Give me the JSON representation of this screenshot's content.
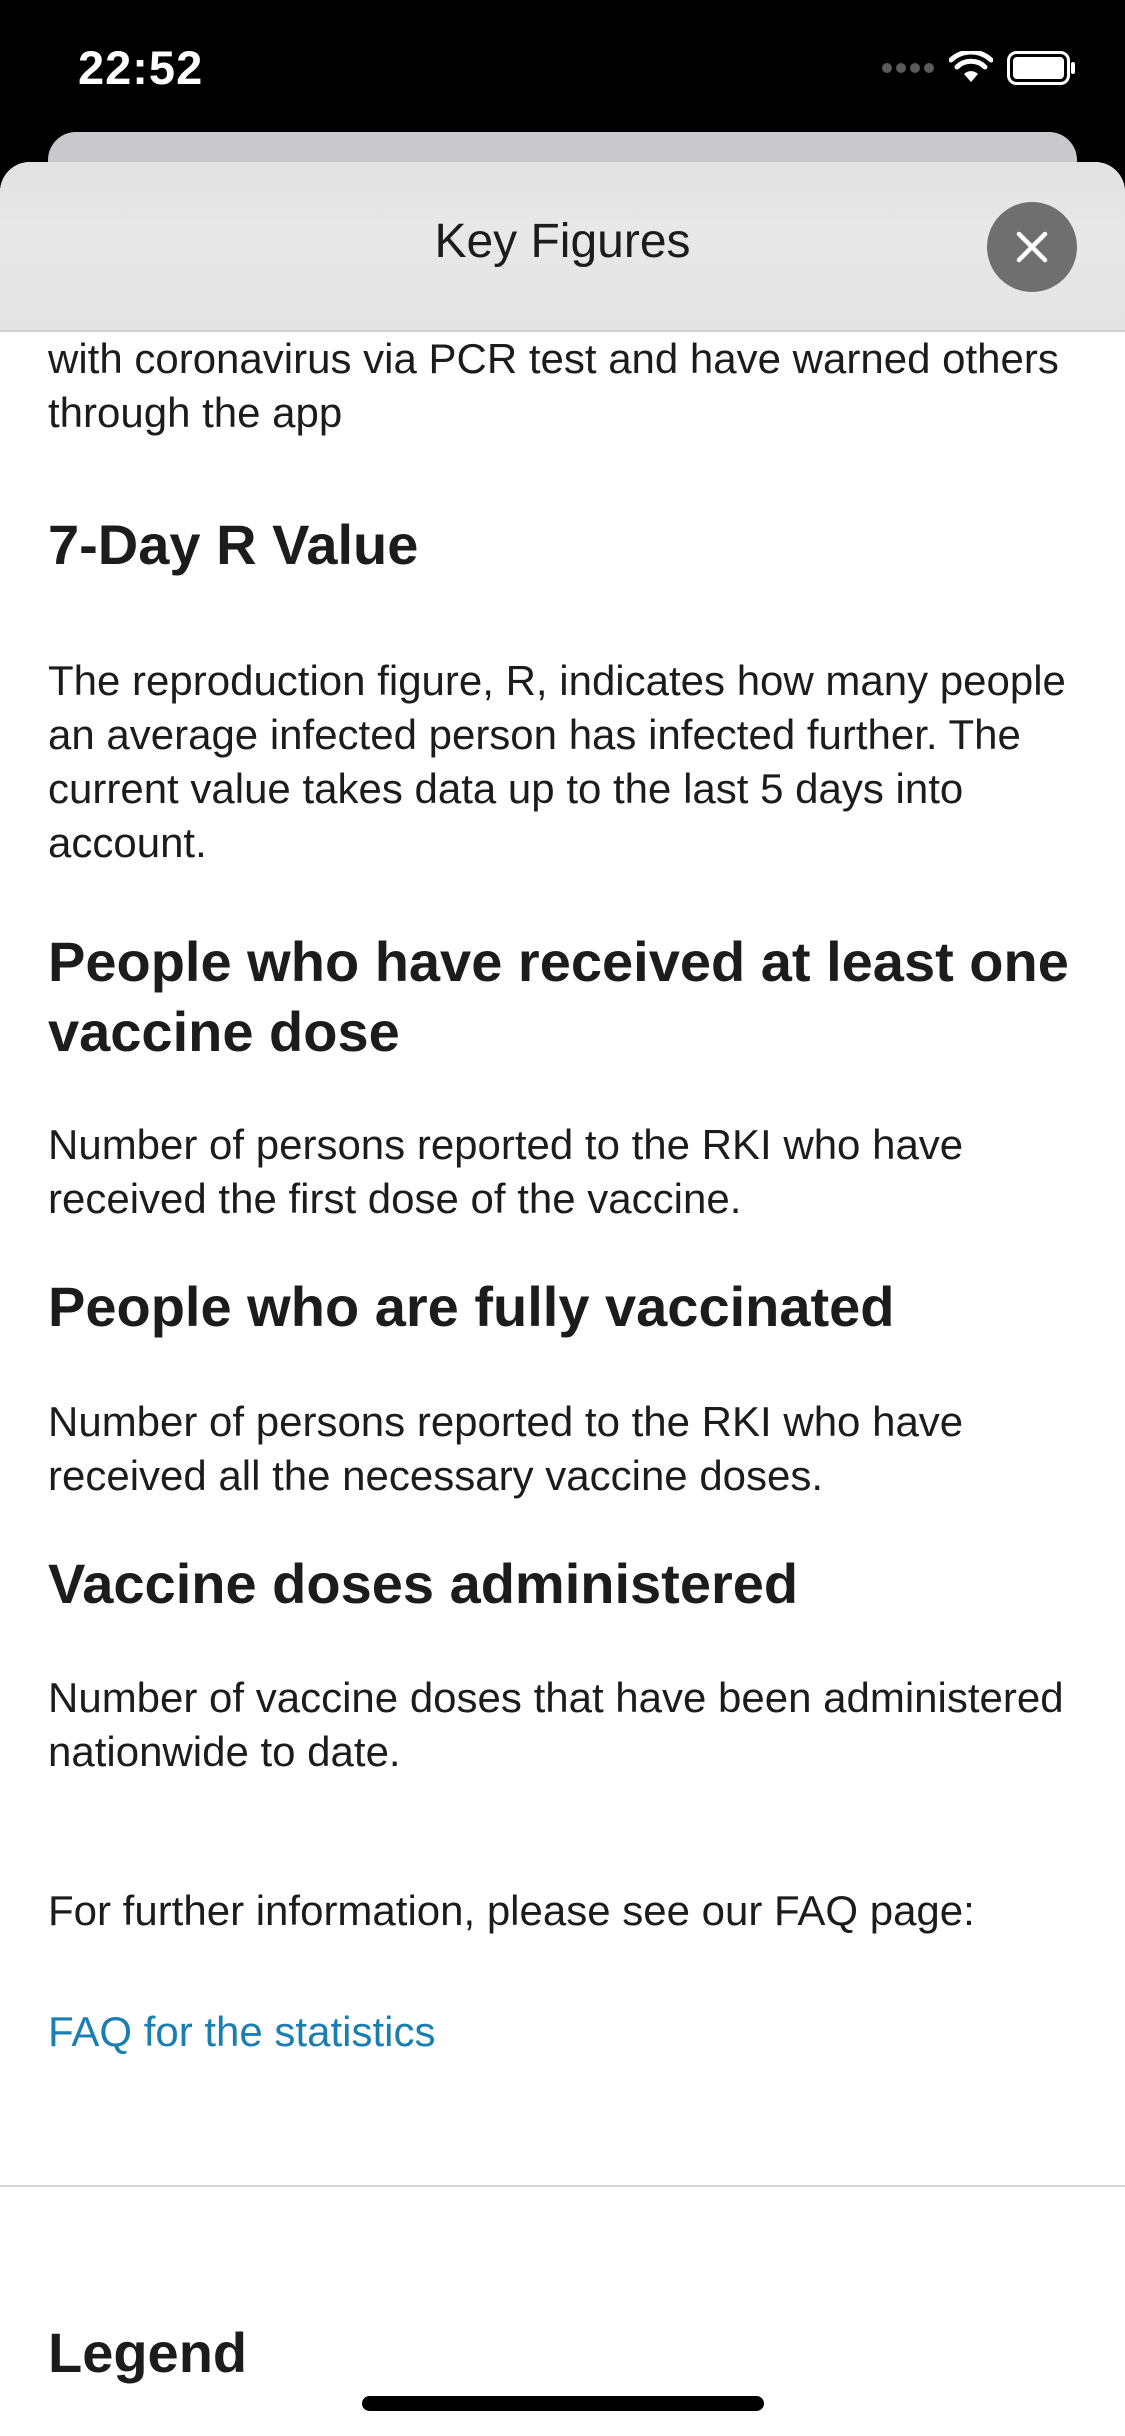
{
  "status_bar": {
    "time": "22:52"
  },
  "header": {
    "title": "Key Figures",
    "close_icon": "close-icon"
  },
  "sections": {
    "intro_partial": "with coronavirus via PCR test and have warned others through the app",
    "r_value": {
      "heading": "7-Day R Value",
      "body": "The reproduction figure, R, indicates how many people an average infected person has infected further. The current value takes data up to the last 5 days into account."
    },
    "first_dose": {
      "heading": "People who have received at least one vaccine dose",
      "body": "Number of persons reported to the RKI who have received the first dose of the vaccine."
    },
    "fully_vaccinated": {
      "heading": "People who are fully vaccinated",
      "body": "Number of persons reported to the RKI who have received all the necessary vaccine doses."
    },
    "doses_administered": {
      "heading": "Vaccine doses administered",
      "body": "Number of vaccine doses that have been administered nationwide to date."
    },
    "faq": {
      "text": "For further information, please see our FAQ page:",
      "link": "FAQ for the statistics"
    },
    "legend": {
      "heading": "Legend"
    }
  },
  "colors": {
    "link": "#1a7fb0",
    "close_button_bg": "#6f6f6f"
  }
}
